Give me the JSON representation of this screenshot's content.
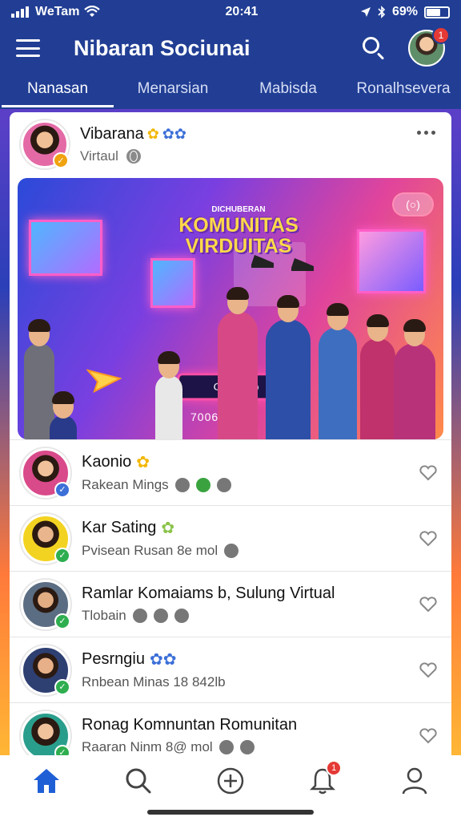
{
  "status_bar": {
    "carrier": "WeTam",
    "time": "20:41",
    "battery": "69%",
    "battery_level": 0.69,
    "icons": [
      "signal-icon",
      "wifi-icon",
      "location-icon",
      "bluetooth-icon",
      "battery-icon"
    ]
  },
  "app_bar": {
    "title": "Nibaran Sociunai",
    "notification_count": "1"
  },
  "tabs": [
    {
      "label": "Nanasan",
      "active": true
    },
    {
      "label": "Menarsian",
      "active": false
    },
    {
      "label": "Mabisda",
      "active": false
    },
    {
      "label": "Ronalhsevera",
      "active": false
    }
  ],
  "post": {
    "author": "Vibarana",
    "subtitle": "Virtaul",
    "banner": {
      "kicker": "DICHUBERAN",
      "title_line1": "KOMUNITAS",
      "title_line2": "VIRDUITAS",
      "platform_label": "Oircuoao",
      "counter": "7006 · 610",
      "toggle_label": "(○)"
    }
  },
  "list_items": [
    {
      "title": "Kaonio",
      "subtitle": "Rakean Mings",
      "badge_color": "#3c6fd8",
      "emoji": "🌼"
    },
    {
      "title": "Kar Sating",
      "subtitle": "Pvisean Rusan 8e mol",
      "badge_color": "#2eae4f",
      "emoji": "🌼"
    },
    {
      "title": "Ramlar Komaiams b, Sulung Virtual",
      "subtitle": "Tlobain",
      "badge_color": "#2eae4f",
      "emoji": ""
    },
    {
      "title": "Pesrngiu",
      "subtitle": "Rnbean Minas 18 842lb",
      "badge_color": "#2eae4f",
      "emoji": "💙"
    },
    {
      "title": "Ronag Komnuntan Romunitan",
      "subtitle": "Raaran Ninm 8@ mol",
      "badge_color": "#2eae4f",
      "emoji": ""
    }
  ],
  "bottom_nav": {
    "items": [
      "home-icon",
      "search-icon",
      "add-icon",
      "bell-icon",
      "profile-icon"
    ],
    "bell_badge": "1"
  },
  "colors": {
    "primary": "#213e94",
    "accent": "#1f5fd6",
    "badge": "#e53935",
    "verified": "#2eae4f"
  }
}
